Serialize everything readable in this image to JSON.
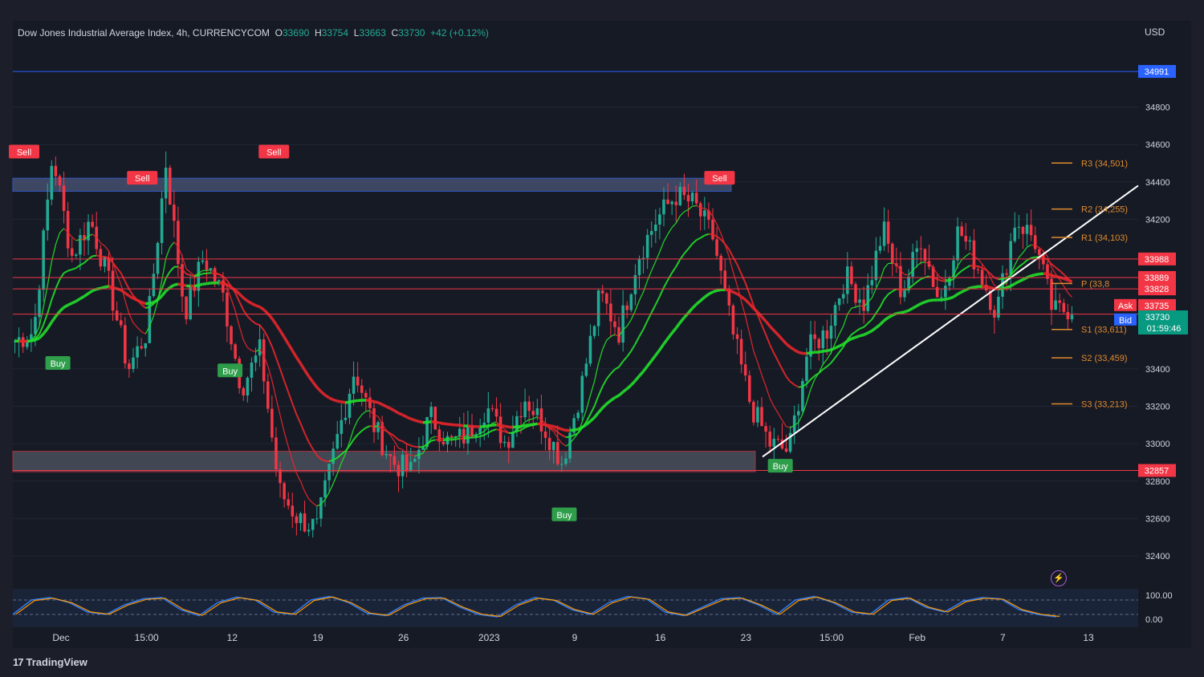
{
  "header": {
    "symbol": "Dow Jones Industrial Average Index, 4h, CURRENCYCOM",
    "o_label": "O",
    "o_value": "33690",
    "h_label": "H",
    "h_value": "33754",
    "l_label": "L",
    "l_value": "33663",
    "c_label": "C",
    "c_value": "33730",
    "change": "+42 (+0.12%)"
  },
  "currency": "USD",
  "footer": {
    "brand": "TradingView"
  },
  "colors": {
    "up": "#22ab94",
    "down": "#f23645",
    "ema": "#22e02a",
    "sell": "#f23645",
    "buy": "#2e9e4a",
    "pivot": "#e08a2c",
    "bg": "#161a25"
  },
  "chart_data": {
    "type": "candlestick",
    "title": "Dow Jones Industrial Average Index, 4h, CURRENCYCOM",
    "ylim": [
      32250,
      35150
    ],
    "y_ticks": [
      32400,
      32600,
      32800,
      33000,
      33200,
      33400,
      34200,
      34400,
      34600,
      34800
    ],
    "x_ticks": [
      "Dec",
      "15:00",
      "12",
      "19",
      "26",
      "2023",
      "9",
      "16",
      "23",
      "15:00",
      "Feb",
      "7",
      "13"
    ],
    "price_path": [
      33550,
      33600,
      34550,
      34000,
      34200,
      33850,
      33400,
      33600,
      34500,
      33700,
      34000,
      33800,
      33300,
      33500,
      32750,
      32600,
      32550,
      33000,
      33400,
      33100,
      32900,
      32850,
      33150,
      33000,
      33050,
      33200,
      33000,
      33250,
      33100,
      32900,
      33300,
      33800,
      33600,
      34000,
      34200,
      34330,
      34280,
      34100,
      33600,
      33200,
      33000,
      32960,
      33500,
      33600,
      33900,
      33750,
      34150,
      33800,
      34100,
      33750,
      34150,
      33950,
      33700,
      34200,
      34100,
      33700,
      33730
    ],
    "horizontal_levels": [
      {
        "label": "34991",
        "value": 34991,
        "color": "#2962ff"
      },
      {
        "label": "33988",
        "value": 33988,
        "color": "#f23645"
      },
      {
        "label": "33889",
        "value": 33889,
        "color": "#f23645"
      },
      {
        "label": "33828",
        "value": 33828,
        "color": "#f23645"
      },
      {
        "label": "33693",
        "value": 33693,
        "color": "#f23645"
      },
      {
        "label": "32857",
        "value": 32857,
        "color": "#f23645"
      }
    ],
    "pivots": [
      {
        "label": "R3 (34,501)",
        "value": 34501
      },
      {
        "label": "R2 (34,255)",
        "value": 34255
      },
      {
        "label": "R1 (34,103)",
        "value": 34103
      },
      {
        "label": "P (33,8",
        "value": 33857
      },
      {
        "label": "S1 (33,611)",
        "value": 33611
      },
      {
        "label": "S2 (33,459)",
        "value": 33459
      },
      {
        "label": "S3 (33,213)",
        "value": 33213
      }
    ],
    "ask": {
      "label": "Ask",
      "value": "33735"
    },
    "bid": {
      "label": "Bid",
      "value": "33731"
    },
    "last": {
      "value": "33730",
      "countdown": "01:59:46"
    },
    "signals": [
      {
        "type": "Sell",
        "label": "Sell",
        "x": 0.01,
        "y": 34560
      },
      {
        "type": "Sell",
        "label": "Sell",
        "x": 0.115,
        "y": 34420
      },
      {
        "type": "Sell",
        "label": "Sell",
        "x": 0.232,
        "y": 34560
      },
      {
        "type": "Sell",
        "label": "Sell",
        "x": 0.628,
        "y": 34420
      },
      {
        "type": "Buy",
        "label": "Buy",
        "x": 0.04,
        "y": 33430
      },
      {
        "type": "Buy",
        "label": "Buy",
        "x": 0.193,
        "y": 33390
      },
      {
        "type": "Buy",
        "label": "Buy",
        "x": 0.49,
        "y": 32620
      },
      {
        "type": "Buy",
        "label": "Buy",
        "x": 0.682,
        "y": 32880
      }
    ],
    "oscillator": {
      "labels": [
        "100.00",
        "0.00"
      ],
      "ylim": [
        0,
        100
      ],
      "values": [
        20,
        80,
        90,
        70,
        30,
        20,
        60,
        85,
        90,
        40,
        15,
        70,
        92,
        80,
        30,
        20,
        80,
        95,
        70,
        25,
        15,
        60,
        88,
        90,
        50,
        20,
        10,
        60,
        90,
        80,
        40,
        20,
        70,
        95,
        85,
        30,
        15,
        50,
        85,
        90,
        60,
        20,
        80,
        95,
        70,
        30,
        20,
        80,
        90,
        50,
        30,
        75,
        90,
        85,
        40,
        20,
        10
      ]
    }
  }
}
